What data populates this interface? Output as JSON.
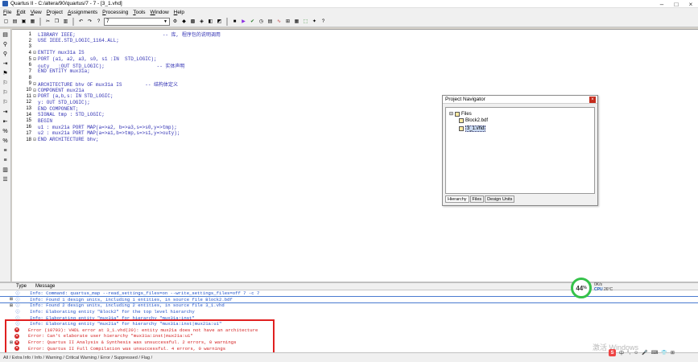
{
  "window": {
    "title": "Quartus II - C:/altera/90/quartus/7 - 7 - [3_1.vhd]"
  },
  "menu": [
    "File",
    "Edit",
    "View",
    "Project",
    "Assignments",
    "Processing",
    "Tools",
    "Window",
    "Help"
  ],
  "toolbar": {
    "entity_combo": "7"
  },
  "editor": {
    "lines": [
      {
        "n": "1",
        "fold": "",
        "text": "LIBRARY IEEE;                              -- 库, 程序包的说明调用"
      },
      {
        "n": "2",
        "fold": "",
        "text": "USE IEEE.STD_LOGIC_1164.ALL;"
      },
      {
        "n": "3",
        "fold": "",
        "text": ""
      },
      {
        "n": "4",
        "fold": "⊟",
        "text": "ENTITY mux31a IS"
      },
      {
        "n": "5",
        "fold": "⊟",
        "text": "PORT (a1, a2, a3, s0, s1 :IN  STD_LOGIC);"
      },
      {
        "n": "6",
        "fold": "",
        "text": "outy   :OUT STD_LOGIC);                  -- 实体声明"
      },
      {
        "n": "7",
        "fold": "",
        "text": "END ENTITY mux31a;"
      },
      {
        "n": "8",
        "fold": "",
        "text": ""
      },
      {
        "n": "9",
        "fold": "⊟",
        "text": "ARCHITECTURE bhv OF mux31a IS        -- 结构体定义"
      },
      {
        "n": "10",
        "fold": "⊟",
        "text": "COMPONENT mux21a"
      },
      {
        "n": "11",
        "fold": "⊟",
        "text": "PORT (a,b,s: IN STD_LOGIC;"
      },
      {
        "n": "12",
        "fold": "",
        "text": "y: OUT STD_LOGIC);"
      },
      {
        "n": "13",
        "fold": "",
        "text": "END COMPONENT;"
      },
      {
        "n": "14",
        "fold": "",
        "text": "SIGNAL tmp : STD_LOGIC;"
      },
      {
        "n": "15",
        "fold": "",
        "text": "BEGIN"
      },
      {
        "n": "16",
        "fold": "",
        "text": "u1 : mux21a PORT MAP(a=>a2, b=>a3,s=>s0,y=>tmp);"
      },
      {
        "n": "17",
        "fold": "",
        "text": "u2 : mux21a PORT MAP(a=>a1,b=>tmp,s=>s1,y=>outy);"
      },
      {
        "n": "18",
        "fold": "⊟",
        "text": "END ARCHITECTURE bhv;"
      }
    ]
  },
  "navigator": {
    "title": "Project Navigator",
    "root": "Files",
    "items": [
      "Block2.bdf",
      "3_1.vhd"
    ],
    "tabs": [
      "Hierarchy",
      "Files",
      "Design Units"
    ]
  },
  "messages": {
    "col_type": "Type",
    "col_message": "Message",
    "rows": [
      {
        "kind": "info",
        "exp": "",
        "text": "Info: Command: quartus_map --read_settings_files=on --write_settings_files=off 7 -c 7"
      },
      {
        "kind": "info",
        "exp": "⊞",
        "text": "Info: Found 1 design units, including 1 entities, in source file Block2.bdf",
        "selected": true
      },
      {
        "kind": "info",
        "exp": "⊞",
        "text": "Info: Found 2 design units, including 2 entities, in source file 3_1.vhd"
      },
      {
        "kind": "info",
        "exp": "",
        "text": "Info: Elaborating entity \"Block2\" for the top level hierarchy"
      },
      {
        "kind": "info",
        "exp": "",
        "text": "Info: Elaborating entity \"mux31a\" for hierarchy \"mux31a:inst\""
      },
      {
        "kind": "info",
        "exp": "",
        "text": "Info: Elaborating entity \"mux21a\" for hierarchy \"mux31a:inst|mux21a:u1\""
      },
      {
        "kind": "err",
        "exp": "",
        "text": "Error (10793): VHDL error at 3_1.vhd(20): entity mux21a does not have an architecture"
      },
      {
        "kind": "err",
        "exp": "",
        "text": "Error: Can't elaborate user hierarchy \"mux31a:inst|mux21a:u1\""
      },
      {
        "kind": "err",
        "exp": "⊞",
        "text": "Error: Quartus II Analysis & Synthesis was unsuccessful. 2 errors, 0 warnings"
      },
      {
        "kind": "err",
        "exp": "",
        "text": "Error: Quartus II Full Compilation was unsuccessful. 4 errors, 0 warnings"
      }
    ]
  },
  "statusbar": {
    "text": "All / Extra Info / Info / Warning / Critical Warning / Error / Suppressed / Flag /"
  },
  "monitor": {
    "percent": "44",
    "percent_unit": "%",
    "cpu_label": "CPU",
    "cpu_value": "26°C",
    "net_value": "0K/s"
  },
  "watermark": "激活 Windows",
  "colors": {
    "info": "#1e50c8",
    "error": "#d42020",
    "code": "#3232b4",
    "highlight_box": "#e02020"
  }
}
